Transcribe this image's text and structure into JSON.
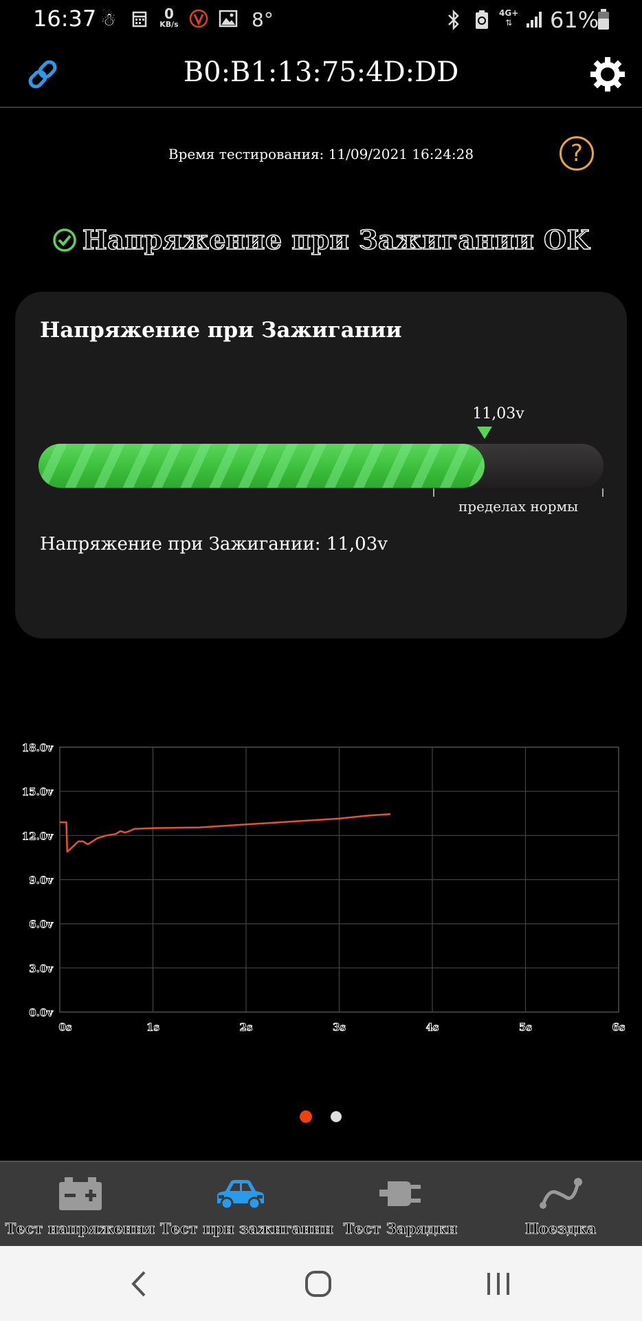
{
  "status_bar": {
    "time": "16:37",
    "network_speed_value": "0",
    "network_speed_unit": "KB/s",
    "temperature": "8°",
    "network_type": "4G+",
    "battery": "61%"
  },
  "header": {
    "device_id": "B0:B1:13:75:4D:DD",
    "link_icon": "link-icon",
    "settings_icon": "gear-icon"
  },
  "test_time": "Время тестирования: 11/09/2021 16:24:28",
  "help_symbol": "?",
  "result": {
    "text": "Напряжение при Зажигании OK",
    "status_color": "#5bd35b"
  },
  "card": {
    "title": "Напряжение при Зажигании",
    "marker_value": "11,03v",
    "progress_fraction": 0.79,
    "norm_label": "пределах нормы",
    "reading": "Напряжение при Зажигании: 11,03v"
  },
  "chart_data": {
    "type": "line",
    "title": "",
    "xlabel": "",
    "ylabel": "",
    "xlim": [
      0,
      6
    ],
    "ylim": [
      0,
      18
    ],
    "x_ticks": [
      "0s",
      "1s",
      "2s",
      "3s",
      "4s",
      "5s",
      "6s"
    ],
    "y_ticks": [
      "0.0v",
      "3.0v",
      "6.0v",
      "9.0v",
      "12.0v",
      "15.0v",
      "18.0v"
    ],
    "grid": true,
    "line_color": "#e8532a",
    "series": [
      {
        "x": [
          0.0,
          0.07,
          0.08,
          0.1,
          0.15,
          0.2,
          0.25,
          0.3,
          0.35,
          0.4,
          0.5,
          0.6,
          0.65,
          0.7,
          0.75,
          0.8,
          1.0,
          1.5,
          2.0,
          2.5,
          3.0,
          3.3,
          3.55
        ],
        "y": [
          12.9,
          12.9,
          10.9,
          11.0,
          11.3,
          11.6,
          11.6,
          11.4,
          11.6,
          11.8,
          12.0,
          12.1,
          12.3,
          12.2,
          12.3,
          12.45,
          12.5,
          12.55,
          12.75,
          12.95,
          13.15,
          13.35,
          13.45
        ]
      }
    ]
  },
  "pager": {
    "active_color": "#f04010",
    "inactive_color": "#dddddd"
  },
  "bottom_nav": {
    "items": [
      {
        "label": "Тест напряжения",
        "icon": "battery-icon"
      },
      {
        "label": "Тест при зажигании",
        "icon": "car-icon"
      },
      {
        "label": "Тест Зарядки",
        "icon": "plug-icon"
      },
      {
        "label": "Поездка",
        "icon": "route-icon"
      }
    ],
    "active_color": "#2a9be8",
    "inactive_color": "#9a9a9a"
  },
  "system_nav": {
    "back_icon": "back-icon",
    "home_icon": "home-icon",
    "recents_icon": "recents-icon"
  }
}
